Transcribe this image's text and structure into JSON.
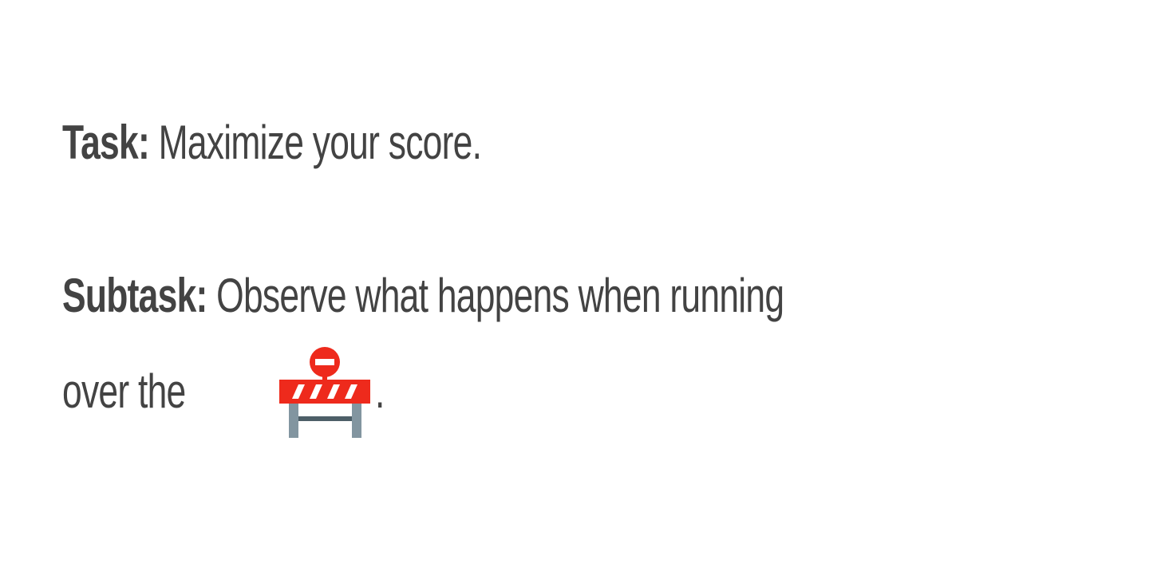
{
  "task": {
    "label": "Task:",
    "text": "Maximize your score."
  },
  "subtask": {
    "label": "Subtask:",
    "line1": "Observe what happens when running",
    "line2_before": "over the",
    "line2_after": "."
  },
  "icons": {
    "barrier": "construction-barrier-icon"
  },
  "colors": {
    "text": "#434343",
    "background": "#ffffff",
    "barrier_red": "#ee2a1c",
    "barrier_post": "#8295a0"
  }
}
